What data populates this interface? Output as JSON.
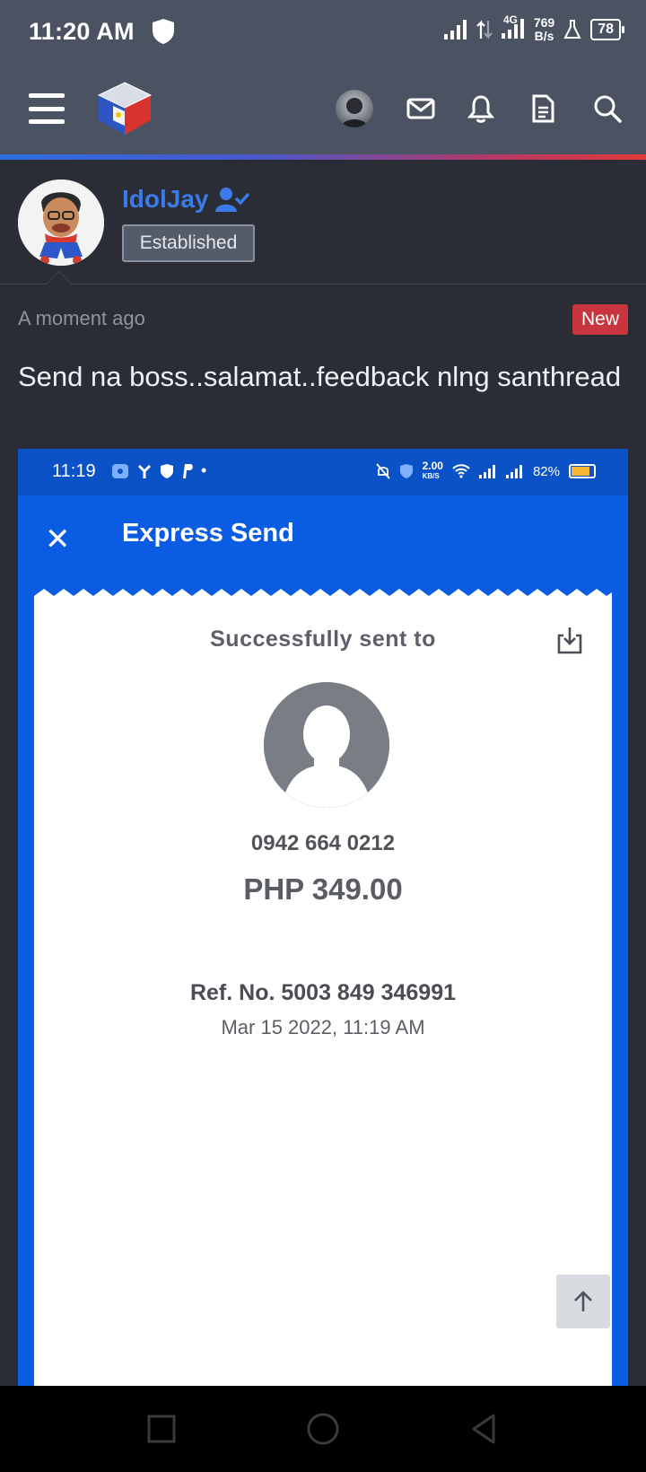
{
  "status_bar": {
    "time": "11:20 AM",
    "network_type": "4G",
    "speed_value": "769",
    "speed_unit": "B/s",
    "battery": "78"
  },
  "header": {
    "icons": [
      "menu-icon",
      "site-logo",
      "user-avatar",
      "mail-icon",
      "bell-icon",
      "document-icon",
      "search-icon"
    ]
  },
  "post": {
    "author": "IdolJay",
    "author_badge": "Established",
    "timestamp": "A moment ago",
    "new_badge": "New",
    "text": "Send na boss..salamat..feedback nlng santhread"
  },
  "embedded": {
    "status_time": "11:19",
    "status_speed": "2.00",
    "status_speed_unit": "KB/S",
    "status_battery": "82%",
    "title": "Express Send",
    "heading": "Successfully sent to",
    "phone": "0942 664 0212",
    "amount": "PHP 349.00",
    "ref": "Ref. No. 5003 849 346991",
    "date": "Mar 15 2022, 11:19 AM"
  },
  "colors": {
    "accent_blue": "#3b7be9",
    "header_bg": "#4b5261",
    "page_bg": "#2a2d36",
    "new_badge": "#c9353f",
    "gcash_blue": "#0a5ce2"
  }
}
